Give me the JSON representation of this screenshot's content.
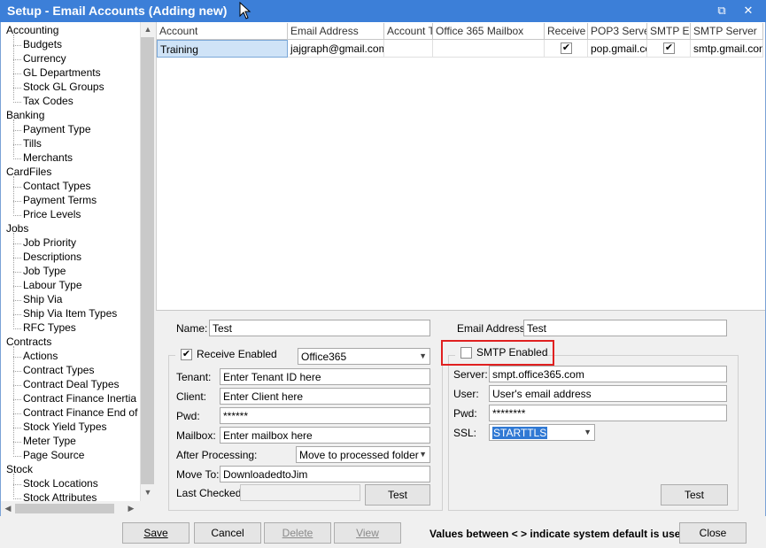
{
  "window": {
    "title": "Setup - Email Accounts (Adding new)",
    "restore_glyph": "⧉",
    "close_glyph": "✕"
  },
  "tree": [
    {
      "category": "Accounting",
      "items": [
        "Budgets",
        "Currency",
        "GL Departments",
        "Stock GL Groups",
        "Tax Codes"
      ]
    },
    {
      "category": "Banking",
      "items": [
        "Payment Type",
        "Tills",
        "Merchants"
      ]
    },
    {
      "category": "CardFiles",
      "items": [
        "Contact Types",
        "Payment Terms",
        "Price Levels"
      ]
    },
    {
      "category": "Jobs",
      "items": [
        "Job Priority",
        "Descriptions",
        "Job Type",
        "Labour Type",
        "Ship Via",
        "Ship Via Item Types",
        "RFC Types"
      ]
    },
    {
      "category": "Contracts",
      "items": [
        "Actions",
        "Contract Types",
        "Contract Deal Types",
        "Contract Finance Inertia",
        "Contract Finance End of Te",
        "Stock Yield Types",
        "Meter Type",
        "Page Source"
      ]
    },
    {
      "category": "Stock",
      "items": [
        "Stock Locations",
        "Stock Attributes"
      ]
    }
  ],
  "grid": {
    "columns": [
      "Account",
      "Email Address",
      "Account Ty",
      "Office 365 Mailbox",
      "Receive E",
      "POP3 Server",
      "SMTP Ena",
      "SMTP Server"
    ],
    "rows": [
      {
        "account": "Training",
        "email": "jajgraph@gmail.com",
        "account_type": "",
        "mailbox": "",
        "receive_enabled": true,
        "pop3": "pop.gmail.com",
        "smtp_enabled": true,
        "smtp_server": "smtp.gmail.com"
      }
    ]
  },
  "form": {
    "name_label": "Name:",
    "name_value": "Test",
    "email_label": "Email Address:",
    "email_value": "Test",
    "receive_enabled_label": "Receive Enabled",
    "receive_enabled_checked": true,
    "receive_type": "Office365",
    "tenant_label": "Tenant:",
    "tenant_value": "Enter Tenant ID here",
    "client_label": "Client:",
    "client_value": "Enter Client here",
    "pwd_label": "Pwd:",
    "pwd_value": "******",
    "mailbox_label": "Mailbox:",
    "mailbox_value": "Enter mailbox here",
    "after_label": "After Processing:",
    "after_value": "Move to processed folder",
    "moveto_label": "Move To:",
    "moveto_value": "DownloadedtoJim",
    "lastchecked_label": "Last Checked",
    "lastchecked_value": "",
    "test_label": "Test",
    "smtp_enabled_label": "SMTP Enabled",
    "smtp_enabled_checked": false,
    "server_label": "Server:",
    "server_value": "smpt.office365.com",
    "user_label": "User:",
    "user_value": "User's email address",
    "smtp_pwd_label": "Pwd:",
    "smtp_pwd_value": "********",
    "ssl_label": "SSL:",
    "ssl_value": "STARTTLS",
    "smtp_test_label": "Test",
    "highlight_color": "#e02020",
    "selection_color": "#3079d4"
  },
  "footer": {
    "save": "Save",
    "cancel": "Cancel",
    "delete": "Delete",
    "view": "View",
    "message": "Values between < > indicate system default is use",
    "close": "Close"
  }
}
